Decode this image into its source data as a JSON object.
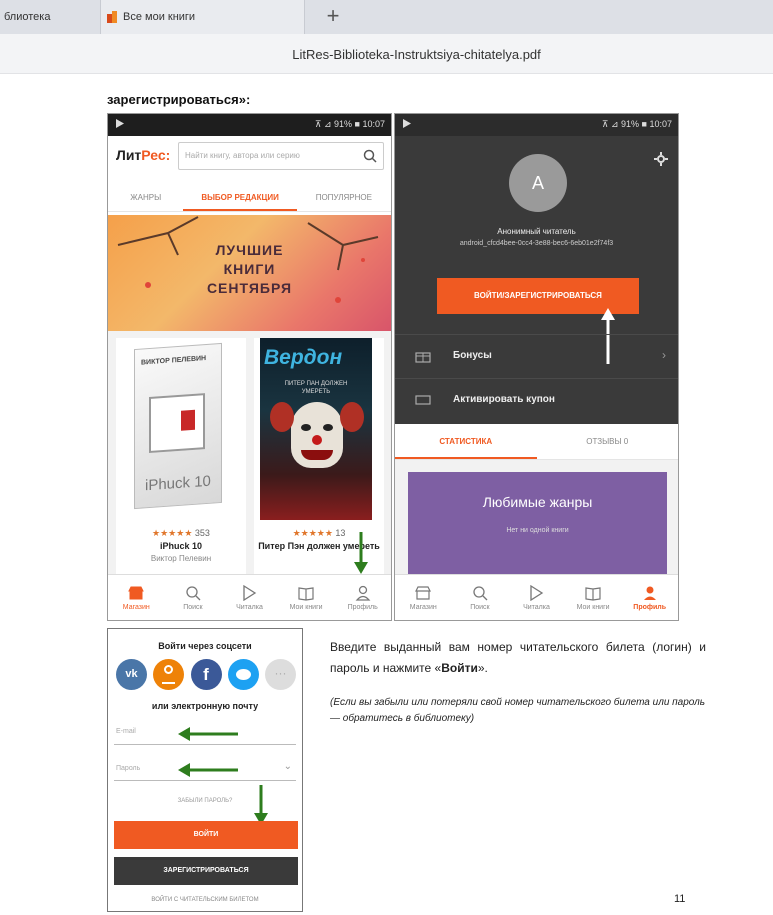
{
  "browser": {
    "tab1_label": "блиотека",
    "tab2_label": "Все мои книги",
    "new_tab": "+",
    "doc_title": "LitRes-Biblioteka-Instruktsiya-chitatelya.pdf"
  },
  "heading": "зарегистрироваться»:",
  "status": {
    "right": "⊼ ⊿ 91% ■ 10:07"
  },
  "left_phone": {
    "logo_a": "Лит",
    "logo_b": "Рес:",
    "search_placeholder": "Найти книгу, автора или серию",
    "tabs": [
      "ЖАНРЫ",
      "ВЫБОР РЕДАКЦИИ",
      "ПОПУЛЯРНОЕ"
    ],
    "banner": [
      "ЛУЧШИЕ",
      "КНИГИ",
      "СЕНТЯБРЯ"
    ],
    "books": [
      {
        "cover_author": "ВИКТОР ПЕЛЕВИН",
        "cover_title": "iPhuck 10",
        "stars": "★★★★★",
        "count": "353",
        "title": "iPhuck 10",
        "author": "Виктор Пелевин"
      },
      {
        "cover_author": "ПИТЕР ПАН ДОЛЖЕН УМЕРЕТЬ",
        "cover_title": "Вердон",
        "stars": "★★★★★",
        "count": "13",
        "title": "Питер Пэн должен умереть",
        "author": "Джон Вердон"
      }
    ],
    "nav": [
      "Магазин",
      "Поиск",
      "Читалка",
      "Мои книги",
      "Профиль"
    ]
  },
  "right_phone": {
    "avatar_letter": "A",
    "user_label": "Анонимный читатель",
    "user_id": "android_cfcd4bee-0cc4-3e88-bec6-6eb01e2f74f3",
    "login_button": "ВОЙТИ/ЗАРЕГИСТРИРОВАТЬСЯ",
    "menu": [
      "Бонусы",
      "Активировать купон"
    ],
    "tabs": [
      "СТАТИСТИКА",
      "ОТЗЫВЫ 0"
    ],
    "card_title": "Любимые жанры",
    "card_sub": "Нет ни одной книги",
    "nav": [
      "Магазин",
      "Поиск",
      "Читалка",
      "Мои книги",
      "Профиль"
    ]
  },
  "login_form": {
    "social_title": "Войти через соцсети",
    "or_email": "или электронную почту",
    "email_placeholder": "E-mail",
    "password_placeholder": "Пароль",
    "forgot": "ЗАБЫЛИ ПАРОЛЬ?",
    "login_button": "ВОЙТИ",
    "register_button": "ЗАРЕГИСТРИРОВАТЬСЯ",
    "library_card": "ВОЙТИ С ЧИТАТЕЛЬСКИМ БИЛЕТОМ"
  },
  "instructions": {
    "main_a": "Введите выданный вам номер читательского билета (логин) и пароль и нажмите «",
    "main_bold": "Войти",
    "main_b": "».",
    "note": "(Если вы забыли или потеряли свой номер читательского билета или пароль — обратитесь в библиотеку)"
  },
  "page_number": "11",
  "colors": {
    "accent": "#f05a22",
    "green_arrow": "#2e7d1e",
    "purple": "#7e5fa3",
    "dark": "#3a3a3a"
  }
}
